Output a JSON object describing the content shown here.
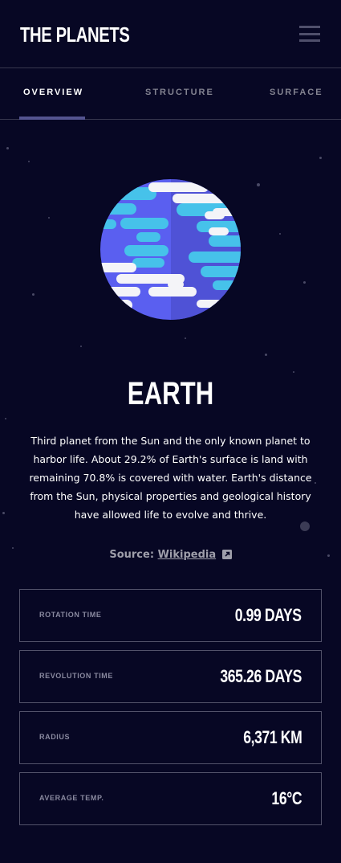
{
  "app": {
    "title": "THE PLANETS"
  },
  "tabs": [
    {
      "label": "OVERVIEW",
      "active": true
    },
    {
      "label": "STRUCTURE",
      "active": false
    },
    {
      "label": "SURFACE",
      "active": false
    }
  ],
  "planet": {
    "name": "EARTH",
    "description": "Third planet from the Sun and the only known planet to harbor life. About 29.2% of Earth's surface is land with remaining 70.8% is covered with water. Earth's distance from the Sun, physical properties and geological history have allowed life to evolve and thrive.",
    "source_label": "Source:",
    "source_link": "Wikipedia"
  },
  "stats": [
    {
      "label": "ROTATION TIME",
      "value": "0.99 DAYS"
    },
    {
      "label": "REVOLUTION TIME",
      "value": "365.26 DAYS"
    },
    {
      "label": "RADIUS",
      "value": "6,371 KM"
    },
    {
      "label": "AVERAGE TEMP.",
      "value": "16°C"
    }
  ],
  "colors": {
    "background": "#070724",
    "divider": "#38384f",
    "tab_indicator": "#545490",
    "planet_blue": "#5a5ff0",
    "planet_cyan": "#46c2ea",
    "cloud_white": "#f4f4f8"
  },
  "icons": [
    "menu-icon",
    "external-link-icon"
  ]
}
